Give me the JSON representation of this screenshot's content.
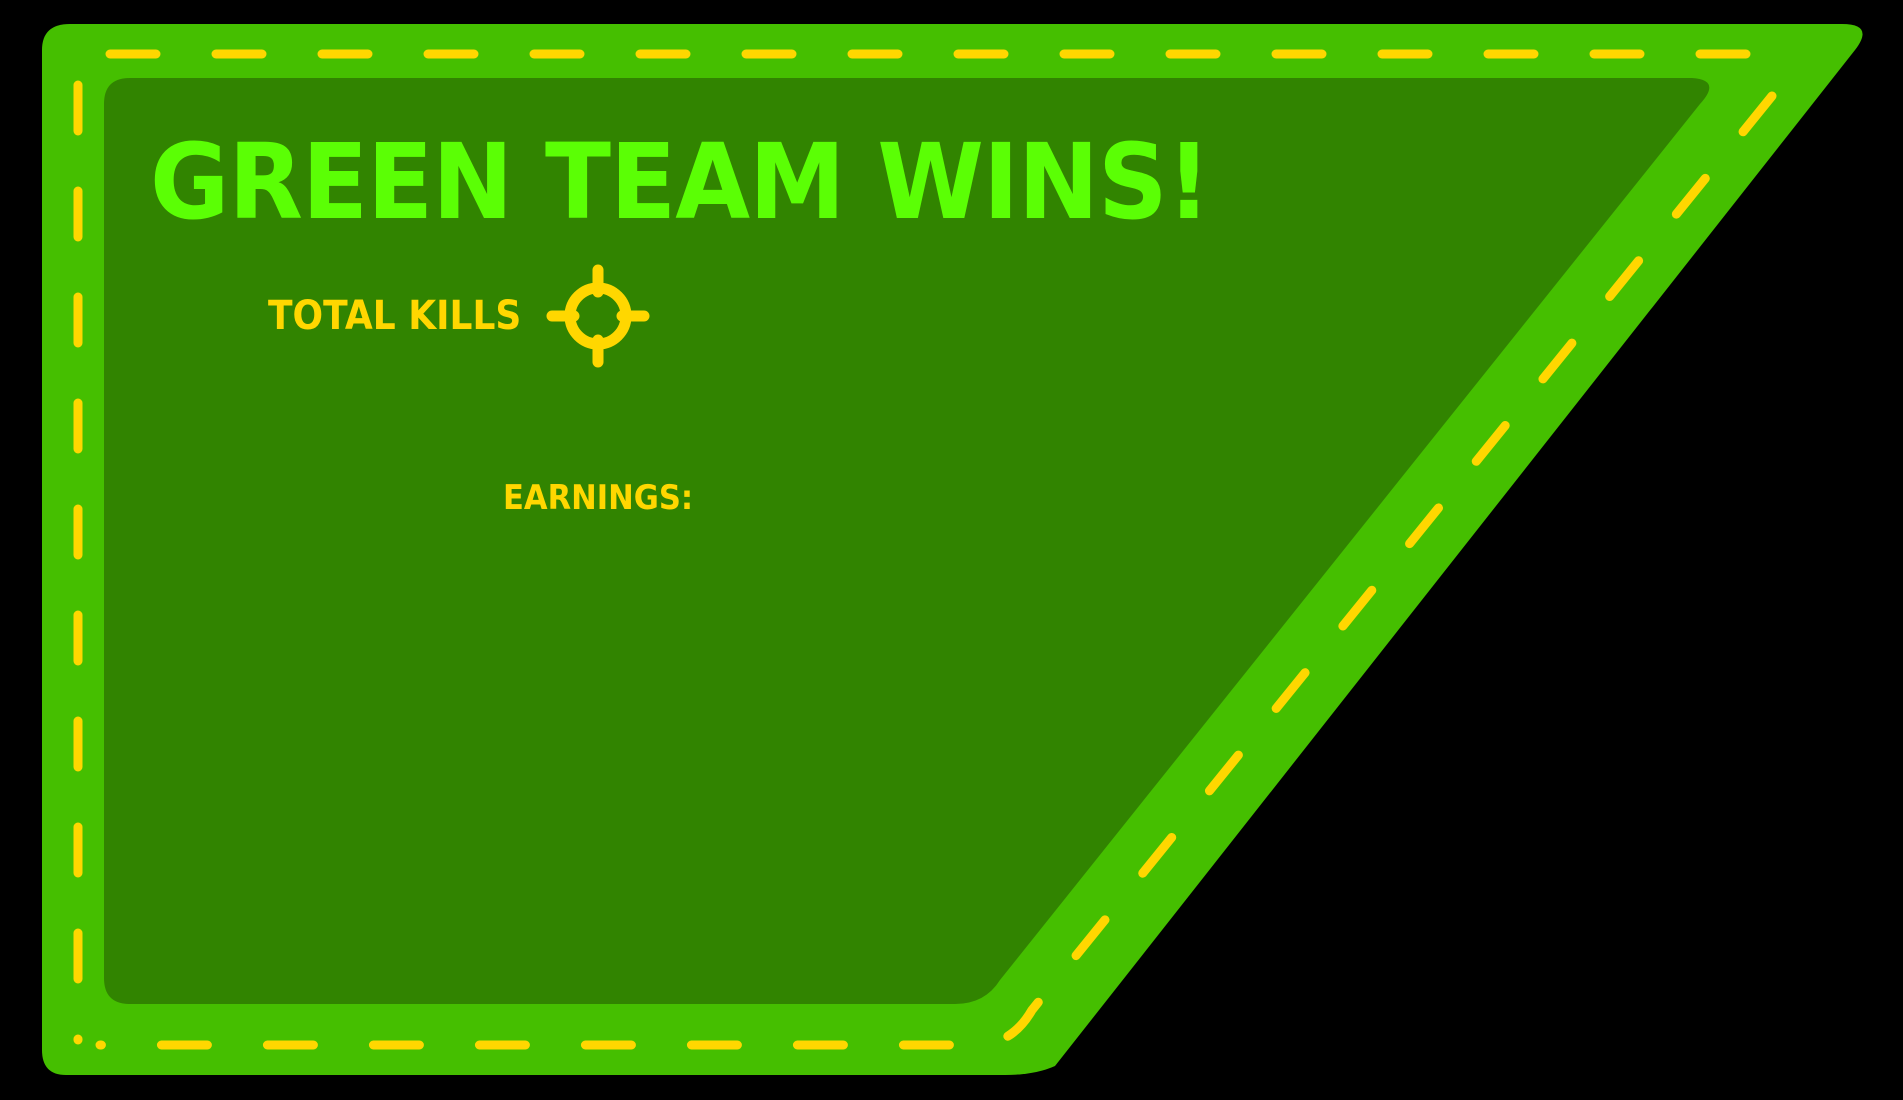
{
  "result_panel": {
    "title": "GREEN TEAM WINS!",
    "kills_label": "TOTAL KILLS",
    "kills_icon": "crosshair-icon",
    "earnings_label": "EARNINGS:"
  },
  "colors": {
    "background": "#000000",
    "panel_border": "#45BF00",
    "panel_fill": "#318400",
    "stitch": "#FFD700",
    "title": "#5BFF05",
    "label": "#FFD700"
  }
}
